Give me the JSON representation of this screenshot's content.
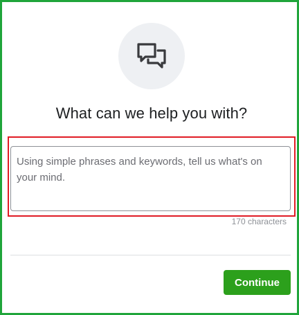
{
  "dialog": {
    "icon": "chat-bubbles-icon",
    "title": "What can we help you with?",
    "input": {
      "value": "",
      "placeholder": "Using simple phrases and keywords, tell us what's on your mind."
    },
    "char_count": "170 characters",
    "continue_label": "Continue"
  },
  "colors": {
    "frame_border": "#1fa53a",
    "highlight_border": "#e01b24",
    "button": "#2ca01c",
    "icon_bg": "#eef0f3"
  }
}
